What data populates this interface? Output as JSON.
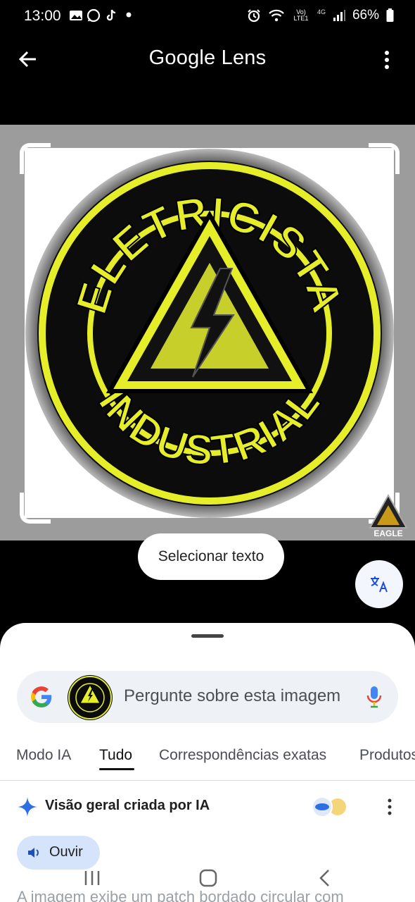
{
  "status_bar": {
    "time": "13:00",
    "network": "Vo) LTE1",
    "network_type": "4G",
    "battery": "66%"
  },
  "app_bar": {
    "title": "Google Lens"
  },
  "image": {
    "patch_top_text": "ELETRICISTA",
    "patch_bottom_text": "INDUSTRIAL",
    "watermark": "EAGLE"
  },
  "select_text_button": "Selecionar texto",
  "search": {
    "placeholder": "Pergunte sobre esta imagem"
  },
  "tabs": [
    "Modo IA",
    "Tudo",
    "Correspondências exatas",
    "Produtos"
  ],
  "ai_overview": {
    "title": "Visão geral criada por IA",
    "listen_label": "Ouvir",
    "text": "A imagem exibe um patch bordado circular com"
  },
  "colors": {
    "patch_yellow": "#e6ee2a",
    "patch_black": "#0c0c0c",
    "google_blue": "#4285f4",
    "google_red": "#ea4335",
    "google_yellow": "#fbbc05",
    "google_green": "#34a853"
  }
}
